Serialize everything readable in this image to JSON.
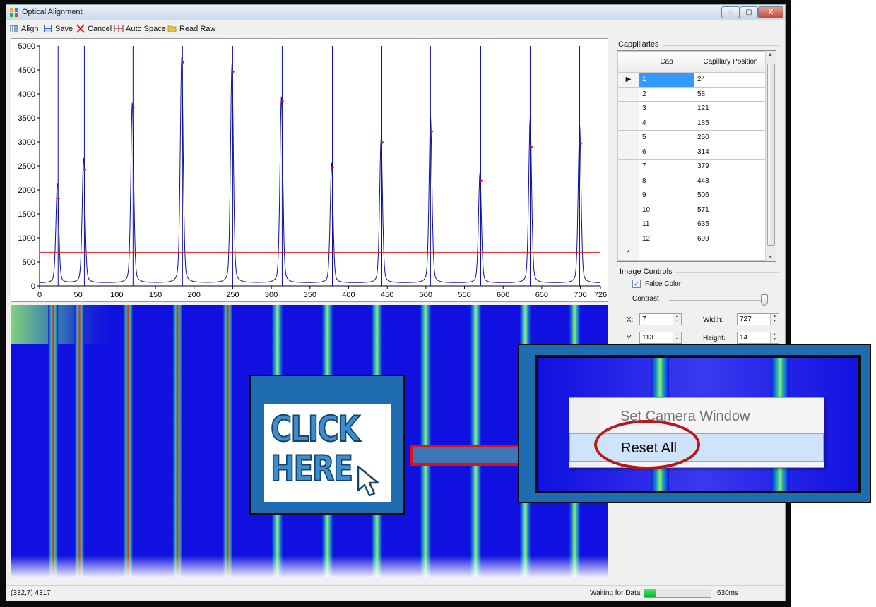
{
  "window": {
    "title": "Optical Alignment",
    "minimize_glyph": "▭",
    "maximize_glyph": "▢",
    "close_glyph": "X"
  },
  "toolbar": {
    "align_label": "Align",
    "save_label": "Save",
    "cancel_label": "Cancel",
    "auto_space_label": "Auto Space",
    "read_raw_label": "Read Raw"
  },
  "chart_data": {
    "type": "line",
    "title": "",
    "xlabel": "",
    "ylabel": "",
    "xlim": [
      0,
      726
    ],
    "ylim": [
      0,
      5000
    ],
    "x_ticks": [
      "0",
      "50",
      "100",
      "150",
      "200",
      "250",
      "300",
      "350",
      "400",
      "450",
      "500",
      "550",
      "600",
      "650",
      "700",
      "726"
    ],
    "y_ticks": [
      "0",
      "500",
      "1000",
      "1500",
      "2000",
      "2500",
      "3000",
      "3500",
      "4000",
      "4500",
      "5000"
    ],
    "threshold": 700,
    "threshold_color": "#e02020",
    "series_color": "#1010a0",
    "peaks": [
      {
        "x": 23,
        "y": 2080,
        "marker": 1800
      },
      {
        "x": 57,
        "y": 2600,
        "marker": 2400
      },
      {
        "x": 120,
        "y": 3750,
        "marker": 3700
      },
      {
        "x": 184,
        "y": 4700,
        "marker": 4650
      },
      {
        "x": 249,
        "y": 4550,
        "marker": 4450
      },
      {
        "x": 313,
        "y": 3880,
        "marker": 3830
      },
      {
        "x": 378,
        "y": 2500,
        "marker": 2450
      },
      {
        "x": 442,
        "y": 3000,
        "marker": 2980
      },
      {
        "x": 506,
        "y": 3480,
        "marker": 3200
      },
      {
        "x": 570,
        "y": 2300,
        "marker": 2180
      },
      {
        "x": 635,
        "y": 3440,
        "marker": 2880
      },
      {
        "x": 699,
        "y": 3300,
        "marker": 2950
      }
    ],
    "cap_lines": [
      24,
      58,
      121,
      185,
      250,
      314,
      379,
      443,
      506,
      571,
      635,
      699
    ]
  },
  "capillaries": {
    "group_label": "Cappillaries",
    "columns": [
      "Cap",
      "Capillary Position"
    ],
    "rows": [
      [
        "1",
        "24"
      ],
      [
        "2",
        "58"
      ],
      [
        "3",
        "121"
      ],
      [
        "4",
        "185"
      ],
      [
        "5",
        "250"
      ],
      [
        "6",
        "314"
      ],
      [
        "7",
        "379"
      ],
      [
        "8",
        "443"
      ],
      [
        "9",
        "506"
      ],
      [
        "10",
        "571"
      ],
      [
        "11",
        "635"
      ],
      [
        "12",
        "699"
      ]
    ],
    "selected_row": 0,
    "new_row_glyph": "*",
    "current_row_glyph": "▶"
  },
  "image_controls": {
    "group_label": "Image Controls",
    "false_color_label": "False Color",
    "false_color_checked": true,
    "contrast_label": "Contrast",
    "contrast_level": 1.0,
    "x_label": "X:",
    "x_value": "7",
    "y_label": "Y:",
    "y_value": "113",
    "width_label": "Width:",
    "width_value": "727",
    "height_label": "Height:",
    "height_value": "14"
  },
  "status": {
    "coords": "(332,7) 4317",
    "waiting_label": "Waiting for Data",
    "progress": 0.17,
    "elapsed": "630ms"
  },
  "callout": {
    "click_line1": "CLICK",
    "click_line2": "HERE",
    "menu_items": [
      "Set Camera Window",
      "Reset All"
    ],
    "highlighted_item": 1,
    "colors": {
      "card": "#1f6db0",
      "ring": "#b81818",
      "arrow_fill": "#3f74b6",
      "arrow_outline": "#e01010"
    }
  }
}
